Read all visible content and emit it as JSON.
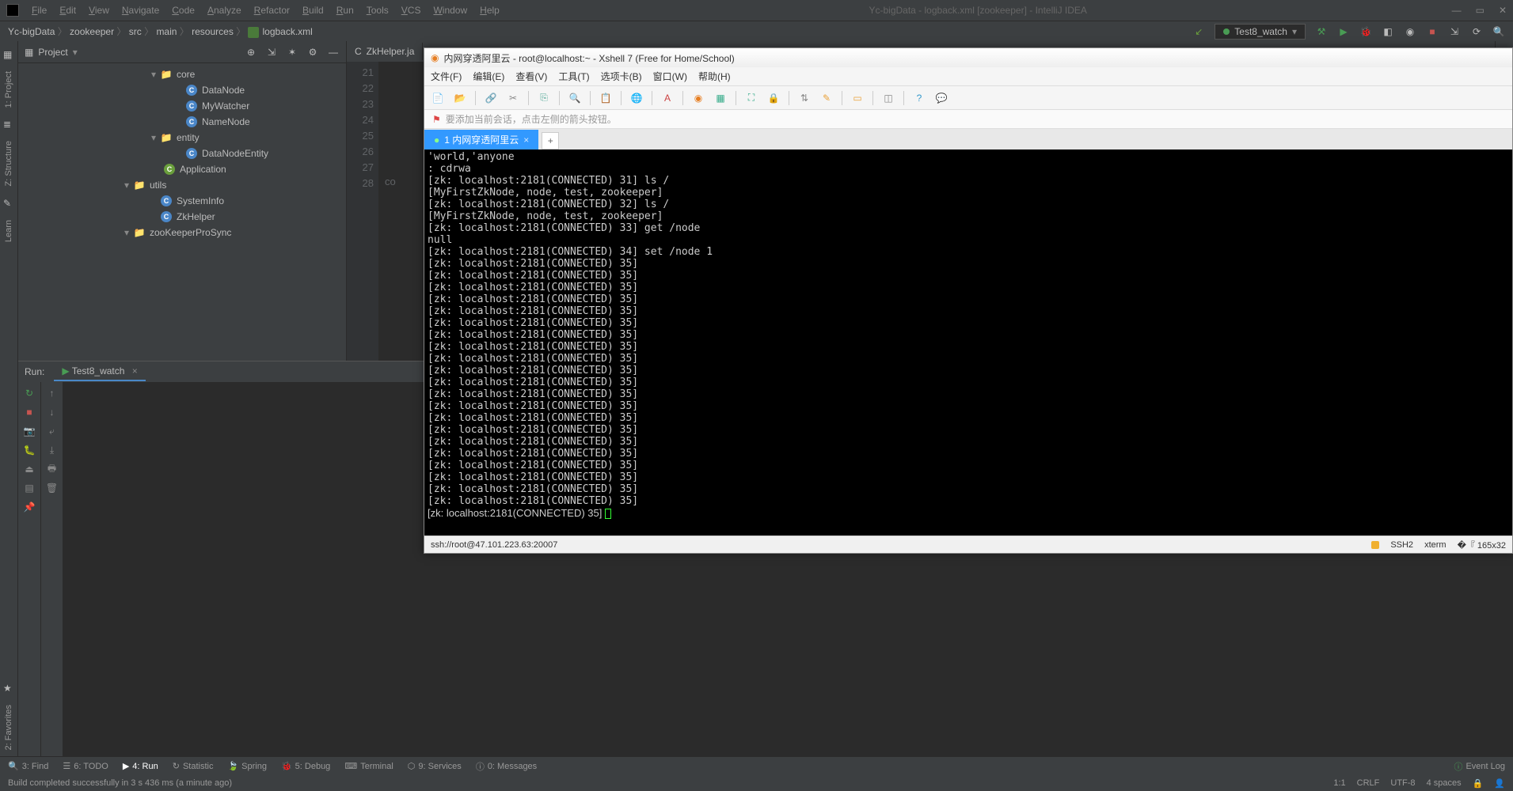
{
  "titlebar": {
    "menus": [
      "File",
      "Edit",
      "View",
      "Navigate",
      "Code",
      "Analyze",
      "Refactor",
      "Build",
      "Run",
      "Tools",
      "VCS",
      "Window",
      "Help"
    ],
    "title": "Yc-bigData - logback.xml [zookeeper] - IntelliJ IDEA",
    "win_min": "—",
    "win_max": "▭",
    "win_close": "✕"
  },
  "breadcrumbs": [
    "Yc-bigData",
    "zookeeper",
    "src",
    "main",
    "resources",
    "logback.xml"
  ],
  "nav_right": {
    "run_config": "Test8_watch",
    "icons": [
      "hammer",
      "play",
      "debug",
      "coverage",
      "profile",
      "stop",
      "attach",
      "commit",
      "search"
    ]
  },
  "sidebar_left": [
    {
      "label": "1: Project",
      "icon": "project-icon"
    },
    {
      "label": "Z: Structure",
      "icon": "structure-icon"
    },
    {
      "label": "Learn",
      "icon": "learn-icon"
    },
    {
      "label": "2: Favorites",
      "icon": "favorites-icon"
    }
  ],
  "project_panel": {
    "title": "Project",
    "items": [
      {
        "indent": 168,
        "arrow": "▾",
        "icon": "folder",
        "label": "core"
      },
      {
        "indent": 200,
        "icon": "class",
        "label": "DataNode"
      },
      {
        "indent": 200,
        "icon": "class",
        "label": "MyWatcher"
      },
      {
        "indent": 200,
        "icon": "class",
        "label": "NameNode"
      },
      {
        "indent": 168,
        "arrow": "▾",
        "icon": "folder",
        "label": "entity"
      },
      {
        "indent": 200,
        "icon": "class",
        "label": "DataNodeEntity"
      },
      {
        "indent": 172,
        "icon": "class-g",
        "label": "Application"
      },
      {
        "indent": 134,
        "arrow": "▾",
        "icon": "folder",
        "label": "utils"
      },
      {
        "indent": 168,
        "icon": "class",
        "label": "SystemInfo"
      },
      {
        "indent": 168,
        "icon": "class",
        "label": "ZkHelper"
      },
      {
        "indent": 134,
        "arrow": "▾",
        "icon": "folder",
        "label": "zooKeeperProSync"
      }
    ]
  },
  "editor": {
    "tab": "ZkHelper.ja",
    "lines": [
      "21",
      "22",
      "23",
      "24",
      "25",
      "26",
      "27",
      "28"
    ],
    "hint": "co"
  },
  "run_panel": {
    "label": "Run:",
    "tab": "Test8_watch"
  },
  "bottom_bar": [
    {
      "icon": "search",
      "label": "3: Find"
    },
    {
      "icon": "list",
      "label": "6: TODO"
    },
    {
      "icon": "play",
      "label": "4: Run",
      "active": true
    },
    {
      "icon": "refresh",
      "label": "Statistic"
    },
    {
      "icon": "leaf",
      "label": "Spring"
    },
    {
      "icon": "bug",
      "label": "5: Debug"
    },
    {
      "icon": "terminal",
      "label": "Terminal"
    },
    {
      "icon": "hex",
      "label": "9: Services"
    },
    {
      "icon": "info",
      "label": "0: Messages"
    }
  ],
  "event_log": "Event Log",
  "status": {
    "msg": "Build completed successfully in 3 s 436 ms (a minute ago)",
    "pos": "1:1",
    "enc": "CRLF",
    "charset": "UTF-8",
    "indent": "4 spaces"
  },
  "xshell": {
    "title": "内网穿透阿里云 - root@localhost:~ - Xshell 7 (Free for Home/School)",
    "menus": [
      "文件(F)",
      "编辑(E)",
      "查看(V)",
      "工具(T)",
      "选项卡(B)",
      "窗口(W)",
      "帮助(H)"
    ],
    "hint": "要添加当前会话，点击左侧的箭头按钮。",
    "tab": "1 内网穿透阿里云",
    "addtab": "+",
    "term_lines": [
      "'world,'anyone",
      ": cdrwa",
      "[zk: localhost:2181(CONNECTED) 31] ls /",
      "[MyFirstZkNode, node, test, zookeeper]",
      "[zk: localhost:2181(CONNECTED) 32] ls /",
      "[MyFirstZkNode, node, test, zookeeper]",
      "[zk: localhost:2181(CONNECTED) 33] get /node",
      "null",
      "[zk: localhost:2181(CONNECTED) 34] set /node 1",
      "[zk: localhost:2181(CONNECTED) 35]",
      "[zk: localhost:2181(CONNECTED) 35]",
      "[zk: localhost:2181(CONNECTED) 35]",
      "[zk: localhost:2181(CONNECTED) 35]",
      "[zk: localhost:2181(CONNECTED) 35]",
      "[zk: localhost:2181(CONNECTED) 35]",
      "[zk: localhost:2181(CONNECTED) 35]",
      "[zk: localhost:2181(CONNECTED) 35]",
      "[zk: localhost:2181(CONNECTED) 35]",
      "[zk: localhost:2181(CONNECTED) 35]",
      "[zk: localhost:2181(CONNECTED) 35]",
      "[zk: localhost:2181(CONNECTED) 35]",
      "[zk: localhost:2181(CONNECTED) 35]",
      "[zk: localhost:2181(CONNECTED) 35]",
      "[zk: localhost:2181(CONNECTED) 35]",
      "[zk: localhost:2181(CONNECTED) 35]",
      "[zk: localhost:2181(CONNECTED) 35]",
      "[zk: localhost:2181(CONNECTED) 35]",
      "[zk: localhost:2181(CONNECTED) 35]",
      "[zk: localhost:2181(CONNECTED) 35]",
      "[zk: localhost:2181(CONNECTED) 35]",
      "[zk: localhost:2181(CONNECTED) 35] "
    ],
    "status": {
      "conn": "ssh://root@47.101.223.63:20007",
      "proto": "SSH2",
      "term": "xterm",
      "size": "165x32"
    }
  }
}
